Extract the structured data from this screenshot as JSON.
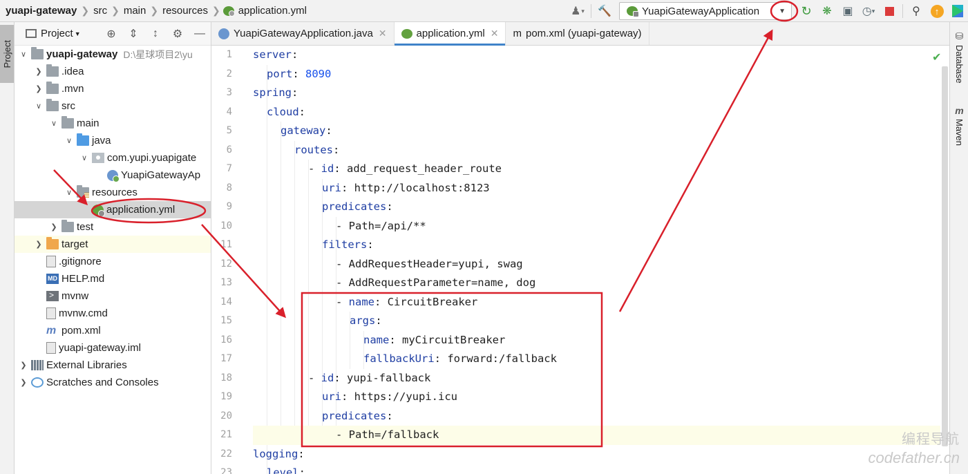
{
  "breadcrumb": {
    "items": [
      "yuapi-gateway",
      "src",
      "main",
      "resources",
      "application.yml"
    ]
  },
  "toolbar": {
    "run_config": "YuapiGatewayApplication",
    "icons": [
      "user-icon",
      "build-hammer-icon",
      "rerun-icon",
      "debug-icon",
      "coverage-icon",
      "profile-icon",
      "stop-icon",
      "search-icon",
      "update-icon",
      "toolbox-icon"
    ]
  },
  "left_strip": {
    "project_tab": "Project"
  },
  "panel": {
    "title": "Project",
    "icons": [
      "locate-icon",
      "expand-all-icon",
      "collapse-all-icon",
      "settings-icon",
      "hide-icon"
    ]
  },
  "tree": [
    {
      "label": "yuapi-gateway",
      "path": "D:\\星球项目2\\yu",
      "icon": "folder",
      "expanded": true
    },
    {
      "label": ".idea",
      "icon": "folder"
    },
    {
      "label": ".mvn",
      "icon": "folder"
    },
    {
      "label": "src",
      "icon": "folder",
      "expanded": true
    },
    {
      "label": "main",
      "icon": "folder",
      "expanded": true
    },
    {
      "label": "java",
      "icon": "folder-blue",
      "expanded": true
    },
    {
      "label": "com.yupi.yuapigate",
      "icon": "package",
      "expanded": true
    },
    {
      "label": "YuapiGatewayAp",
      "icon": "spring-class"
    },
    {
      "label": "resources",
      "icon": "resources-folder",
      "expanded": true
    },
    {
      "label": "application.yml",
      "icon": "yml-file",
      "selected": true
    },
    {
      "label": "test",
      "icon": "folder"
    },
    {
      "label": "target",
      "icon": "folder-orange",
      "highlighted": true
    },
    {
      "label": ".gitignore",
      "icon": "file"
    },
    {
      "label": "HELP.md",
      "icon": "markdown"
    },
    {
      "label": "mvnw",
      "icon": "terminal"
    },
    {
      "label": "mvnw.cmd",
      "icon": "file"
    },
    {
      "label": "pom.xml",
      "icon": "maven"
    },
    {
      "label": "yuapi-gateway.iml",
      "icon": "file"
    },
    {
      "label": "External Libraries",
      "icon": "libraries"
    },
    {
      "label": "Scratches and Consoles",
      "icon": "scratches"
    }
  ],
  "tabs": [
    {
      "label": "YuapiGatewayApplication.java",
      "icon": "spring",
      "closable": true,
      "active": false
    },
    {
      "label": "application.yml",
      "icon": "yml",
      "closable": true,
      "active": true
    },
    {
      "label": "pom.xml (yuapi-gateway)",
      "icon": "maven",
      "closable": false,
      "active": false
    }
  ],
  "code": [
    {
      "n": "1",
      "indent": 0,
      "key": "server",
      "val": ""
    },
    {
      "n": "2",
      "indent": 1,
      "key": "port",
      "val": "8090",
      "num": true
    },
    {
      "n": "3",
      "indent": 0,
      "key": "spring",
      "val": ""
    },
    {
      "n": "4",
      "indent": 1,
      "key": "cloud",
      "val": ""
    },
    {
      "n": "5",
      "indent": 2,
      "key": "gateway",
      "val": ""
    },
    {
      "n": "6",
      "indent": 3,
      "key": "routes",
      "val": ""
    },
    {
      "n": "7",
      "indent": 4,
      "dash": true,
      "key": "id",
      "val": "add_request_header_route"
    },
    {
      "n": "8",
      "indent": 5,
      "key": "uri",
      "val": "http://localhost:8123"
    },
    {
      "n": "9",
      "indent": 5,
      "key": "predicates",
      "val": ""
    },
    {
      "n": "10",
      "indent": 6,
      "dash": true,
      "plain": "Path=/api/**"
    },
    {
      "n": "11",
      "indent": 5,
      "key": "filters",
      "val": ""
    },
    {
      "n": "12",
      "indent": 6,
      "dash": true,
      "plain": "AddRequestHeader=yupi, swag"
    },
    {
      "n": "13",
      "indent": 6,
      "dash": true,
      "plain": "AddRequestParameter=name, dog"
    },
    {
      "n": "14",
      "indent": 6,
      "dash": true,
      "key": "name",
      "val": "CircuitBreaker"
    },
    {
      "n": "15",
      "indent": 7,
      "key": "args",
      "val": ""
    },
    {
      "n": "16",
      "indent": 8,
      "key": "name",
      "val": "myCircuitBreaker"
    },
    {
      "n": "17",
      "indent": 8,
      "key": "fallbackUri",
      "val": "forward:/fallback"
    },
    {
      "n": "18",
      "indent": 4,
      "dash": true,
      "key": "id",
      "val": "yupi-fallback"
    },
    {
      "n": "19",
      "indent": 5,
      "key": "uri",
      "val": "https://yupi.icu"
    },
    {
      "n": "20",
      "indent": 5,
      "key": "predicates",
      "val": ""
    },
    {
      "n": "21",
      "indent": 6,
      "dash": true,
      "plain": "Path=/fallback",
      "current": true
    },
    {
      "n": "22",
      "indent": 0,
      "key": "logging",
      "val": ""
    },
    {
      "n": "23",
      "indent": 1,
      "key": "level",
      "val": ""
    }
  ],
  "right_strip": {
    "tabs": [
      "Database",
      "Maven"
    ]
  },
  "watermark": {
    "line1": "编程导航",
    "line2": "codefather.cn"
  },
  "colors": {
    "annotation_red": "#d9202b",
    "yaml_key": "#1f3ea3",
    "number": "#1750eb",
    "selection": "#d5d5d5",
    "accent": "#4083c9"
  }
}
